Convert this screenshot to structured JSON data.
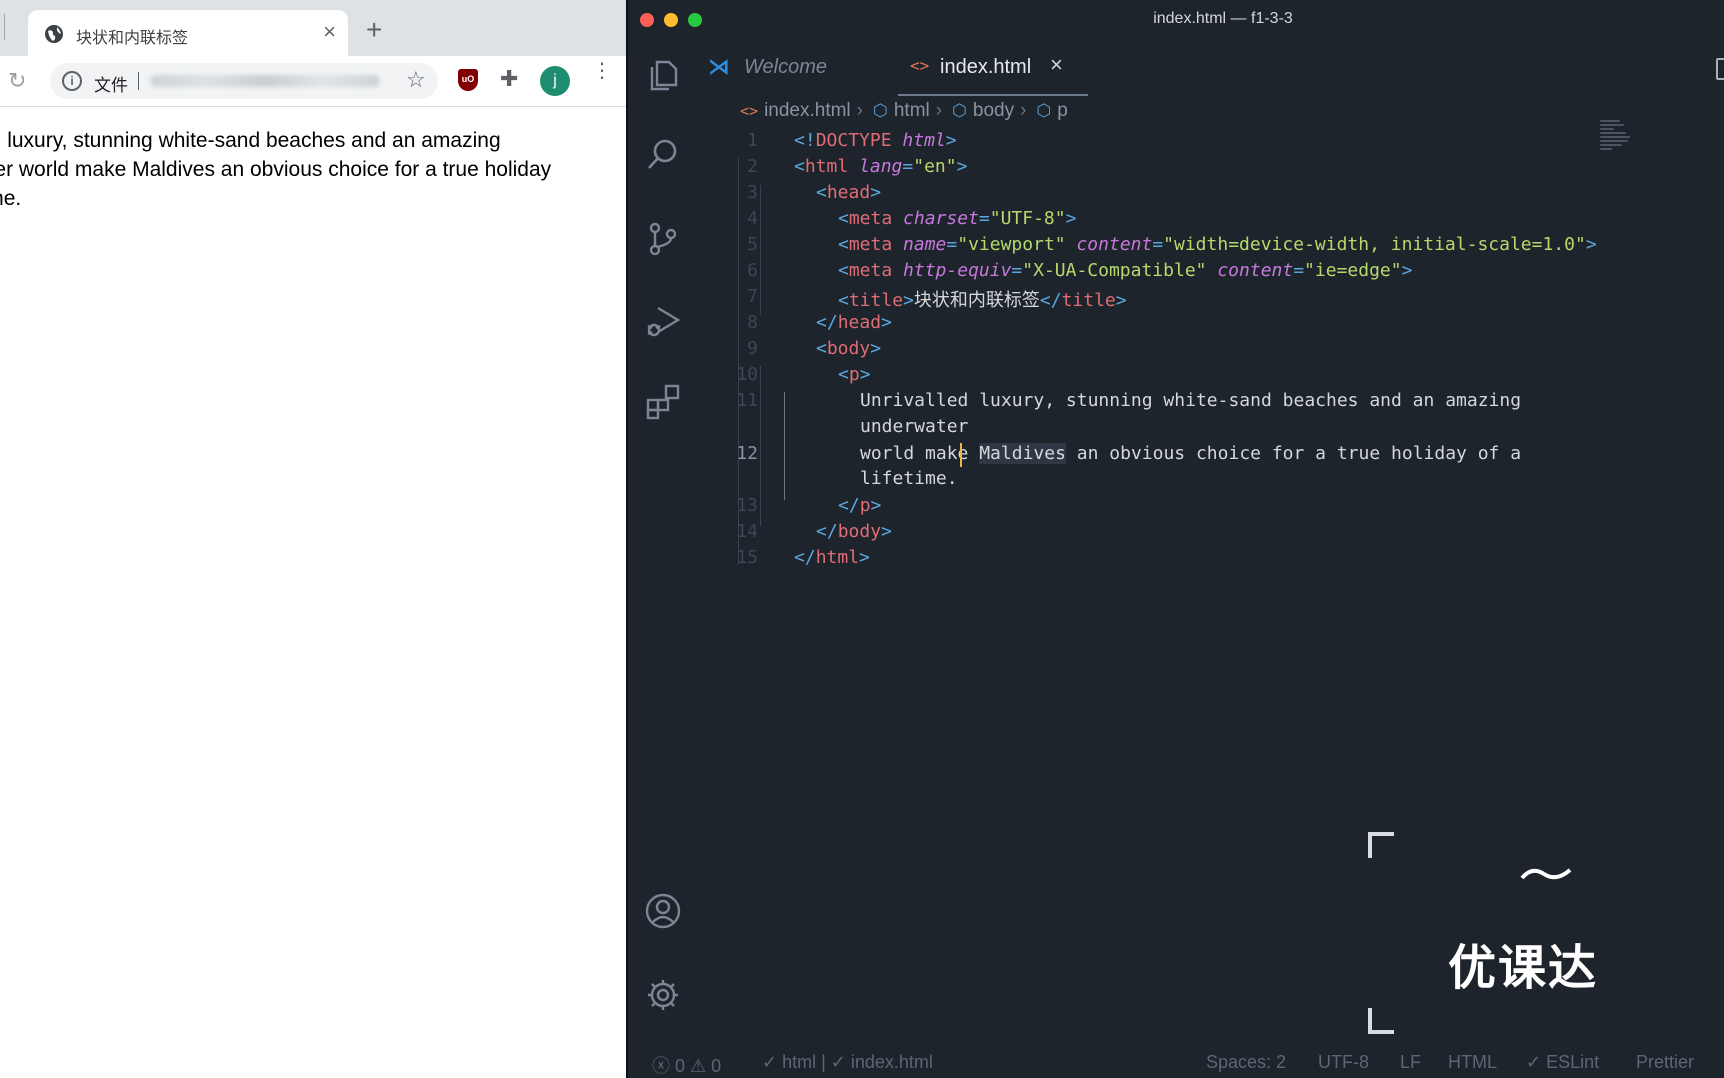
{
  "browser": {
    "tab_title": "块状和内联标签",
    "tab_close": "×",
    "new_tab": "+",
    "url_scheme_label": "文件",
    "avatar_initial": "j",
    "content_lines": [
      "Unrivalled luxury, stunning white-sand beaches and an amazing",
      "underwater world make Maldives an obvious choice for a true holiday",
      "of a lifetime."
    ]
  },
  "vscode": {
    "window_title": "index.html — f1-3-3",
    "tabs": [
      {
        "label": "Welcome"
      },
      {
        "label": "index.html",
        "close": "×"
      }
    ],
    "breadcrumbs": [
      "index.html",
      "html",
      "body",
      "p"
    ],
    "line_numbers": [
      "1",
      "2",
      "3",
      "4",
      "5",
      "6",
      "7",
      "8",
      "9",
      "10",
      "11",
      "12",
      "13",
      "14",
      "15"
    ],
    "code": {
      "l1_a": "<!",
      "l1_b": "DOCTYPE",
      "l1_c": "html",
      "l1_d": ">",
      "l2_tag": "html",
      "l2_attr": "lang",
      "l2_val": "\"en\"",
      "l3_tag": "head",
      "l4_tag": "meta",
      "l4_attr": "charset",
      "l4_val": "\"UTF-8\"",
      "l5_tag": "meta",
      "l5_attr1": "name",
      "l5_val1": "\"viewport\"",
      "l5_attr2": "content",
      "l5_val2": "\"width=device-width, initial-scale=1.0\"",
      "l6_tag": "meta",
      "l6_attr1": "http-equiv",
      "l6_val1": "\"X-UA-Compatible\"",
      "l6_attr2": "content",
      "l6_val2": "\"ie=edge\"",
      "l7_tag": "title",
      "l7_text": "块状和内联标签",
      "l8_tag": "head",
      "l9_tag": "body",
      "l10_tag": "p",
      "l11a": "Unrivalled luxury, stunning white-sand beaches and an amazing",
      "l11b": "underwater",
      "l12a_pre": "world make ",
      "l12a_word": "Maldives",
      "l12a_post": " an obvious choice for a true holiday of a",
      "l12b": "lifetime.",
      "l13_tag": "p",
      "l14_tag": "body",
      "l15_tag": "html"
    },
    "statusbar": {
      "errors": "0",
      "warnings": "0",
      "lang_check": "html | ✓ index.html",
      "spaces": "Spaces: 2",
      "encoding": "UTF-8",
      "eol": "LF",
      "mode": "HTML",
      "eslint": "✓ ESLint",
      "prettier": "Prettier"
    }
  },
  "watermark": {
    "text": "优课达"
  },
  "colors": {
    "editor_bg": "#1e242c",
    "tag": "#5aa8e0",
    "tag_name": "#e06c75",
    "attribute": "#c678dd",
    "string": "#b5d96a",
    "cursor": "#e8b84a"
  }
}
